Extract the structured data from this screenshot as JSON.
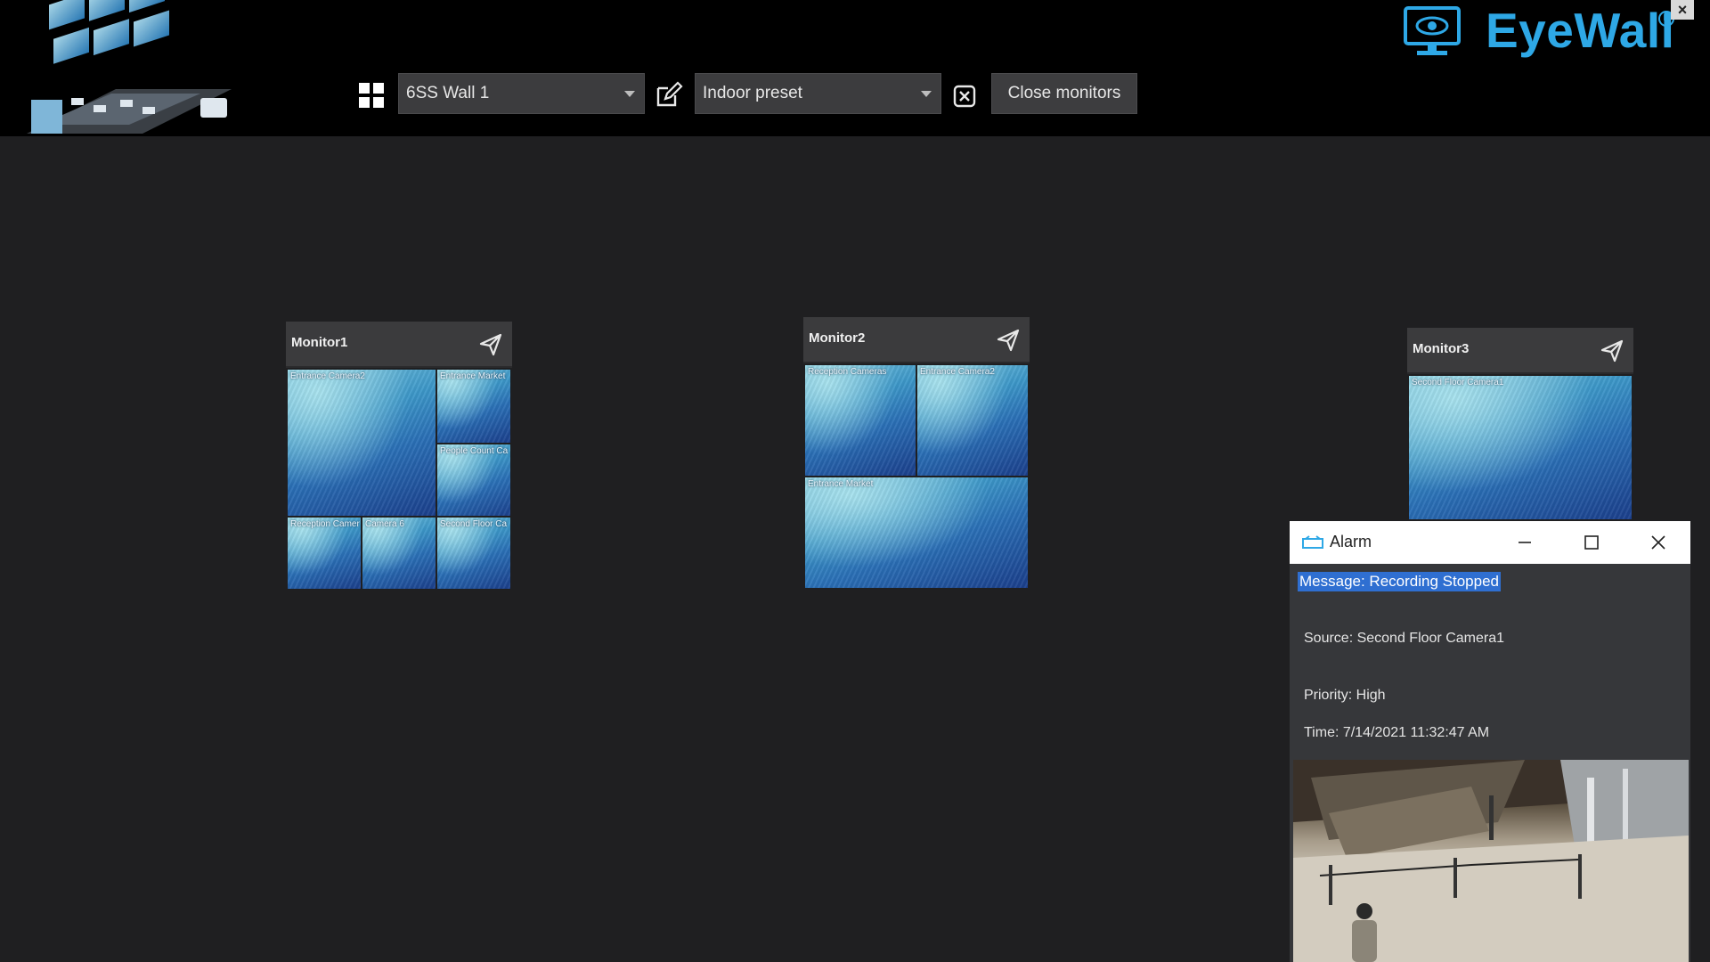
{
  "toolbar": {
    "layout_icon": "grid-icon",
    "wall_select": {
      "value": "6SS Wall 1"
    },
    "edit_icon": "edit-icon",
    "preset_select": {
      "value": "Indoor preset"
    },
    "clear_icon": "clear-square-icon",
    "close_monitors_label": "Close monitors"
  },
  "brand": {
    "name": "EyeWall",
    "icon": "monitor-eye-icon",
    "color": "#2ea8e6"
  },
  "monitors": [
    {
      "title": "Monitor1",
      "tiles": [
        {
          "label": "Entrance Camera2"
        },
        {
          "label": "Entrance Market"
        },
        {
          "label": "People Count Ca"
        },
        {
          "label": "Reception Camer"
        },
        {
          "label": "Camera 6"
        },
        {
          "label": "Second Floor Ca"
        }
      ]
    },
    {
      "title": "Monitor2",
      "tiles": [
        {
          "label": "Reception Cameras"
        },
        {
          "label": "Entrance Camera2"
        },
        {
          "label": "Entrance Market"
        }
      ]
    },
    {
      "title": "Monitor3",
      "tiles": [
        {
          "label": "Second Floor Camera1"
        }
      ]
    }
  ],
  "alarm": {
    "title": "Alarm",
    "message": "Message: Recording Stopped",
    "source": "Source: Second Floor Camera1",
    "priority": "Priority: High",
    "time": "Time: 7/14/2021 11:32:47 AM",
    "highlight_color": "#2f6fd1"
  },
  "window_close_label": "×"
}
